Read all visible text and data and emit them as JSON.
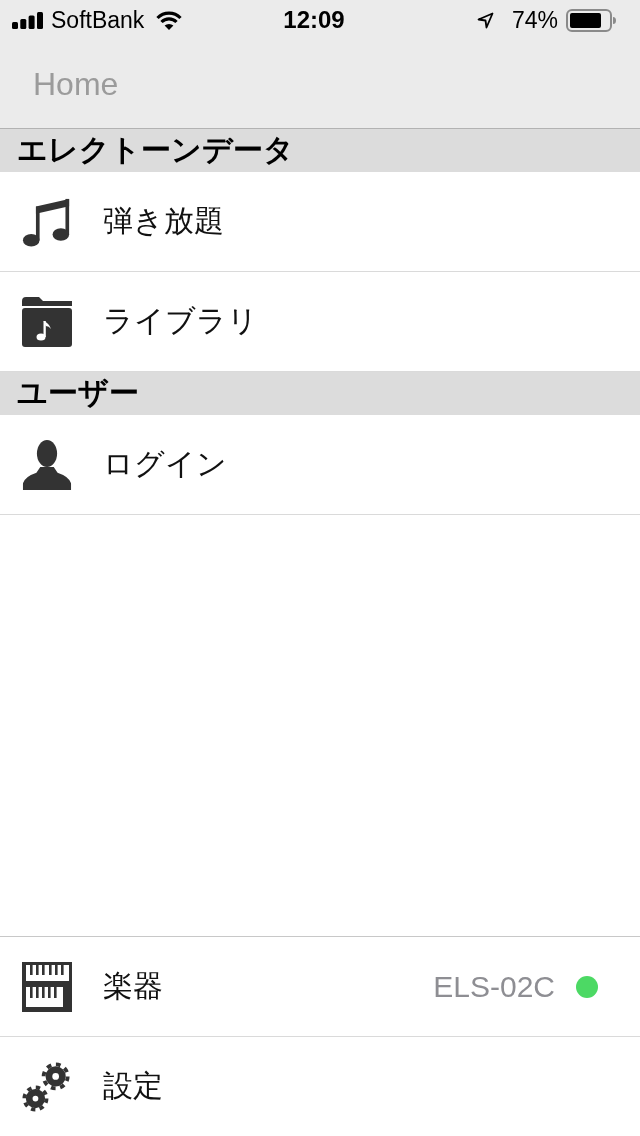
{
  "status_bar": {
    "carrier": "SoftBank",
    "time": "12:09",
    "battery": "74%"
  },
  "nav_bar": {
    "title": "Home"
  },
  "sections": [
    {
      "title": "エレクトーンデータ",
      "items": [
        {
          "label": "弾き放題",
          "kind": "music"
        },
        {
          "label": "ライブラリ",
          "kind": "folder"
        }
      ]
    },
    {
      "title": "ユーザー",
      "items": [
        {
          "label": "ログイン",
          "kind": "person"
        }
      ]
    }
  ],
  "bottom_items": [
    {
      "label": "楽器",
      "kind": "keyboard",
      "value": "ELS-02C",
      "color": "#4cd964"
    },
    {
      "label": "設定",
      "kind": "gears"
    }
  ]
}
